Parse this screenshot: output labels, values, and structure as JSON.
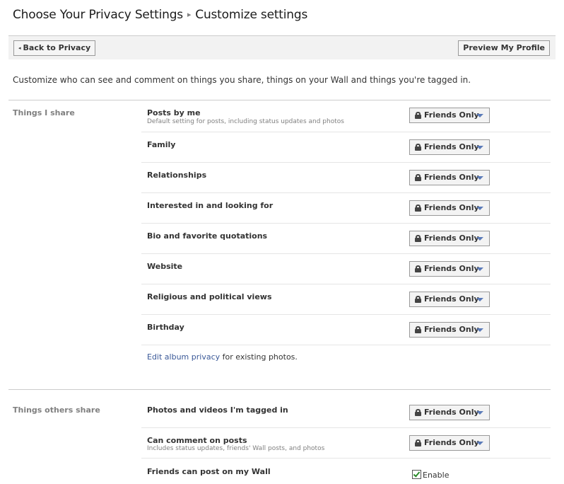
{
  "breadcrumb": {
    "root": "Choose Your Privacy Settings",
    "separator": "▸",
    "current": "Customize settings"
  },
  "toolbar": {
    "back_label": "Back to Privacy",
    "back_arrow": "◂",
    "preview_label": "Preview My Profile"
  },
  "intro_text": "Customize who can see and comment on things you share, things on your Wall and things you're tagged in.",
  "sections": [
    {
      "title": "Things I share",
      "rows": [
        {
          "label": "Posts by me",
          "sub": "Default setting for posts, including status updates and photos",
          "value": "Friends Only"
        },
        {
          "label": "Family",
          "value": "Friends Only"
        },
        {
          "label": "Relationships",
          "value": "Friends Only"
        },
        {
          "label": "Interested in and looking for",
          "value": "Friends Only"
        },
        {
          "label": "Bio and favorite quotations",
          "value": "Friends Only"
        },
        {
          "label": "Website",
          "value": "Friends Only"
        },
        {
          "label": "Religious and political views",
          "value": "Friends Only"
        },
        {
          "label": "Birthday",
          "value": "Friends Only"
        }
      ],
      "album_link": "Edit album privacy",
      "album_suffix": " for existing photos."
    },
    {
      "title": "Things others share",
      "rows": [
        {
          "label": "Photos and videos I'm tagged in",
          "value": "Friends Only"
        },
        {
          "label": "Can comment on posts",
          "sub": "Includes status updates, friends' Wall posts, and photos",
          "value": "Friends Only"
        },
        {
          "label": "Friends can post on my Wall",
          "checkbox_label": "Enable",
          "checked": true
        }
      ]
    }
  ],
  "colors": {
    "link": "#3b5998",
    "caret": "#5a7ab8",
    "check": "#2a8a2a"
  }
}
